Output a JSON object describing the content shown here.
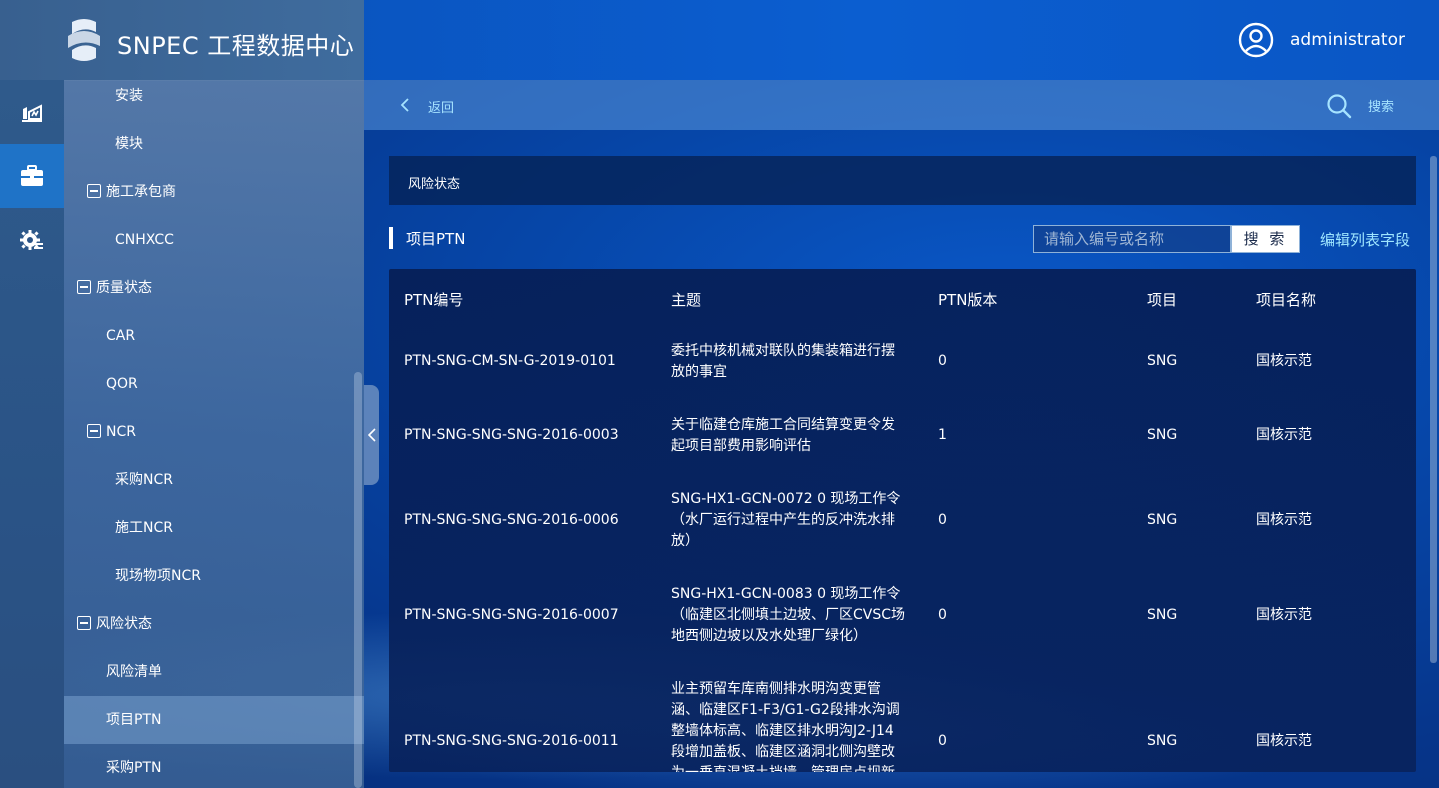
{
  "app": {
    "title": "SNPEC 工程数据中心"
  },
  "user": {
    "name": "administrator"
  },
  "rail": {
    "items": [
      "dashboard-icon",
      "briefcase-icon",
      "gear-settings-icon"
    ],
    "active_index": 1
  },
  "tree": {
    "items": [
      {
        "label": "安装",
        "level": 3
      },
      {
        "label": "模块",
        "level": 3
      },
      {
        "label": "施工承包商",
        "level": 2,
        "expanded": true
      },
      {
        "label": "CNHXCC",
        "level": 3
      },
      {
        "label": "质量状态",
        "level": 1,
        "expanded": true
      },
      {
        "label": "CAR",
        "level": 2
      },
      {
        "label": "QOR",
        "level": 2
      },
      {
        "label": "NCR",
        "level": 2,
        "expanded": true
      },
      {
        "label": "采购NCR",
        "level": 3
      },
      {
        "label": "施工NCR",
        "level": 3
      },
      {
        "label": "现场物项NCR",
        "level": 3
      },
      {
        "label": "风险状态",
        "level": 1,
        "expanded": true
      },
      {
        "label": "风险清单",
        "level": 2
      },
      {
        "label": "项目PTN",
        "level": 2,
        "selected": true
      },
      {
        "label": "采购PTN",
        "level": 2
      }
    ]
  },
  "breadcrumb": {
    "back_label": "返回",
    "search_label": "搜索"
  },
  "section": {
    "title": "风险状态"
  },
  "list": {
    "title": "项目PTN",
    "search_placeholder": "请输入编号或名称",
    "search_button": "搜 索",
    "edit_fields_link": "编辑列表字段"
  },
  "table": {
    "columns": [
      "PTN编号",
      "主题",
      "PTN版本",
      "项目",
      "项目名称"
    ],
    "rows": [
      {
        "id": "PTN-SNG-CM-SN-G-2019-0101",
        "subject": "委托中核机械对联队的集装箱进行摆放的事宜",
        "version": "0",
        "project": "SNG",
        "project_name": "国核示范"
      },
      {
        "id": "PTN-SNG-SNG-SNG-2016-0003",
        "subject": "关于临建仓库施工合同结算变更令发起项目部费用影响评估",
        "version": "1",
        "project": "SNG",
        "project_name": "国核示范"
      },
      {
        "id": "PTN-SNG-SNG-SNG-2016-0006",
        "subject": "SNG-HX1-GCN-0072 0 现场工作令（水厂运行过程中产生的反冲洗水排放）",
        "version": "0",
        "project": "SNG",
        "project_name": "国核示范"
      },
      {
        "id": "PTN-SNG-SNG-SNG-2016-0007",
        "subject": "SNG-HX1-GCN-0083 0 现场工作令（临建区北侧填土边坡、厂区CVSC场地西侧边坡以及水处理厂绿化）",
        "version": "0",
        "project": "SNG",
        "project_name": "国核示范"
      },
      {
        "id": "PTN-SNG-SNG-SNG-2016-0011",
        "subject": "业主预留车库南侧排水明沟变更管涵、临建区F1-F3/G1-G2段排水沟调整墙体标高、临建区排水明沟J2-J14段增加盖板、临建区涵洞北侧沟壁改为一垂直混凝土挡墙，管理房点坝新建",
        "version": "0",
        "project": "SNG",
        "project_name": "国核示范"
      }
    ]
  }
}
